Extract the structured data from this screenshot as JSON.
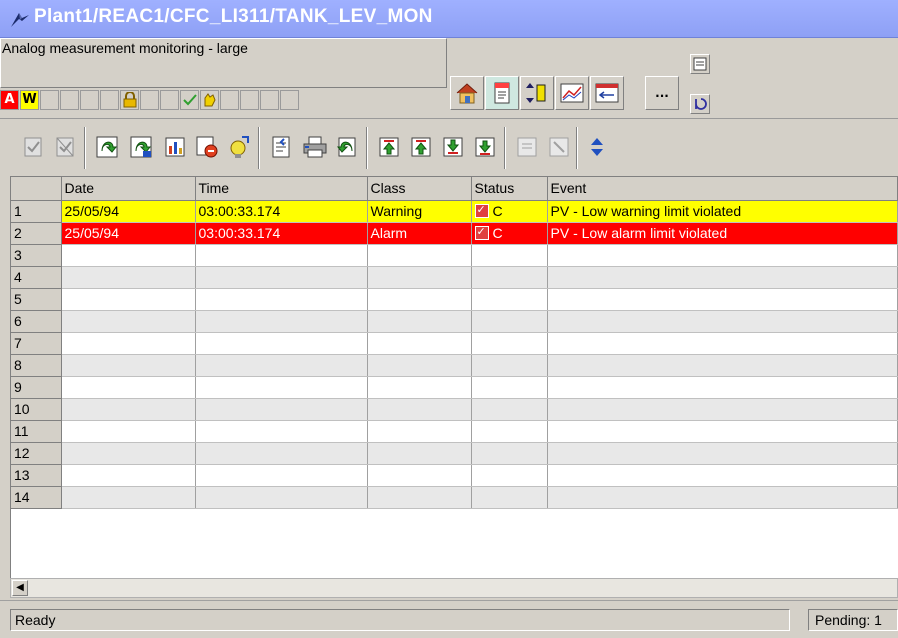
{
  "window": {
    "title": "Plant1/REAC1/CFC_LI311/TANK_LEV_MON"
  },
  "faceplate": {
    "title": "Analog measurement monitoring - large",
    "status_alarm": "A",
    "status_warning": "W",
    "nav_more_label": "..."
  },
  "toolbar": {
    "icons": [
      "acknowledge-disabled-icon",
      "acknowledge-all-disabled-icon",
      "load-icon",
      "load-all-icon",
      "chart-icon",
      "filter-icon",
      "hint-icon",
      "export-icon",
      "print-icon",
      "back-icon",
      "first-icon",
      "prev-icon",
      "next-icon",
      "last-icon",
      "info-disabled-icon",
      "info2-disabled-icon",
      "sort-icon"
    ]
  },
  "table": {
    "headers": [
      "Date",
      "Time",
      "Class",
      "Status",
      "Event"
    ],
    "rows": [
      {
        "num": "1",
        "date": "25/05/94",
        "time": "03:00:33.174",
        "class": "Warning",
        "status": "C",
        "event": "PV - Low warning limit violated",
        "type": "warning"
      },
      {
        "num": "2",
        "date": "25/05/94",
        "time": "03:00:33.174",
        "class": "Alarm",
        "status": "C",
        "event": "PV - Low alarm limit violated",
        "type": "alarm"
      },
      {
        "num": "3"
      },
      {
        "num": "4"
      },
      {
        "num": "5"
      },
      {
        "num": "6"
      },
      {
        "num": "7"
      },
      {
        "num": "8"
      },
      {
        "num": "9"
      },
      {
        "num": "10"
      },
      {
        "num": "11"
      },
      {
        "num": "12"
      },
      {
        "num": "13"
      },
      {
        "num": "14"
      }
    ]
  },
  "statusbar": {
    "ready": "Ready",
    "pending": "Pending: 1"
  },
  "colors": {
    "title_bg": "#9fb0ff",
    "warning": "#ffff00",
    "alarm": "#ff0000"
  }
}
